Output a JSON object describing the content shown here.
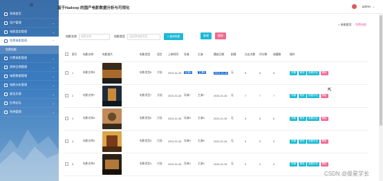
{
  "header": {
    "title": "基于Hadoop 的国产电影数据分析与可视化",
    "user": "admin"
  },
  "sidebar": {
    "items": [
      {
        "label": "系统首页",
        "active": false
      },
      {
        "label": "用户管理",
        "active": false
      },
      {
        "label": "电影类型管理",
        "active": false
      },
      {
        "label": "免费电影管理",
        "active": true
      },
      {
        "label": "付费电影管理",
        "active": false
      },
      {
        "label": "首映日期管理",
        "active": false
      },
      {
        "label": "电影数据管理",
        "active": false
      },
      {
        "label": "电影分析管理",
        "active": false
      },
      {
        "label": "留言反馈",
        "active": false
      },
      {
        "label": "在线论坛",
        "active": false
      },
      {
        "label": "系统管理",
        "active": false
      }
    ],
    "sub_item": "免费电影"
  },
  "breadcrumb": {
    "home": "系统首页",
    "current": "免费电影"
  },
  "search": {
    "label1": "电影名称",
    "placeholder1": "电影名称",
    "label2": "电影类型",
    "placeholder2": "请选择电影类型",
    "button": "查询电影"
  },
  "actions": {
    "add": "新增",
    "delete": "删除"
  },
  "table": {
    "headers": [
      "索引",
      "电影名称",
      "电影图片",
      "电影类型",
      "语言",
      "上映时间",
      "导演",
      "主演",
      "播放日期",
      "剧情",
      "点击次数",
      "评分数",
      "收藏数",
      "操作"
    ],
    "rows": [
      {
        "index": "1",
        "name": "电影名称8",
        "type": "电影类型8",
        "lang": "大陆",
        "date": "2024-01-26",
        "director": "导演8",
        "actor": "主演8",
        "play": "2024-01-26",
        "plot": "无",
        "clicks": "8",
        "score": "8",
        "fav": "8"
      },
      {
        "index": "2",
        "name": "电影名称7",
        "type": "电影类型7",
        "lang": "大陆",
        "date": "2024-01-26",
        "director": "导演7",
        "actor": "主演7",
        "play": "2024-01-26",
        "plot": "无",
        "clicks": "7",
        "score": "7",
        "fav": "7"
      },
      {
        "index": "3",
        "name": "电影名称6",
        "type": "电影类型6",
        "lang": "大陆",
        "date": "2024-01-26",
        "director": "导演6",
        "actor": "主演6",
        "play": "2024-01-26",
        "plot": "无",
        "clicks": "6",
        "score": "6",
        "fav": "6"
      },
      {
        "index": "4",
        "name": "电影名称5",
        "type": "电影类型5",
        "lang": "大陆",
        "date": "2024-01-26",
        "director": "导演5",
        "actor": "主演5",
        "play": "2024-01-26",
        "plot": "无",
        "clicks": "5",
        "score": "5",
        "fav": "5"
      },
      {
        "index": "5",
        "name": "电影名称4",
        "type": "电影类型4",
        "lang": "大陆",
        "date": "2024-01-26",
        "director": "导演4",
        "actor": "主演4",
        "play": "2024-01-26",
        "plot": "无",
        "clicks": "4",
        "score": "4",
        "fav": "4"
      }
    ],
    "ops": {
      "detail": "详情",
      "edit": "修改",
      "review": "查看评论",
      "del": "删除"
    }
  },
  "watermark": "CSDN @俊星学长",
  "colors": {
    "accent": "#1dbad6",
    "danger": "#f06b8f",
    "sidebar": "#3b6ea8"
  }
}
